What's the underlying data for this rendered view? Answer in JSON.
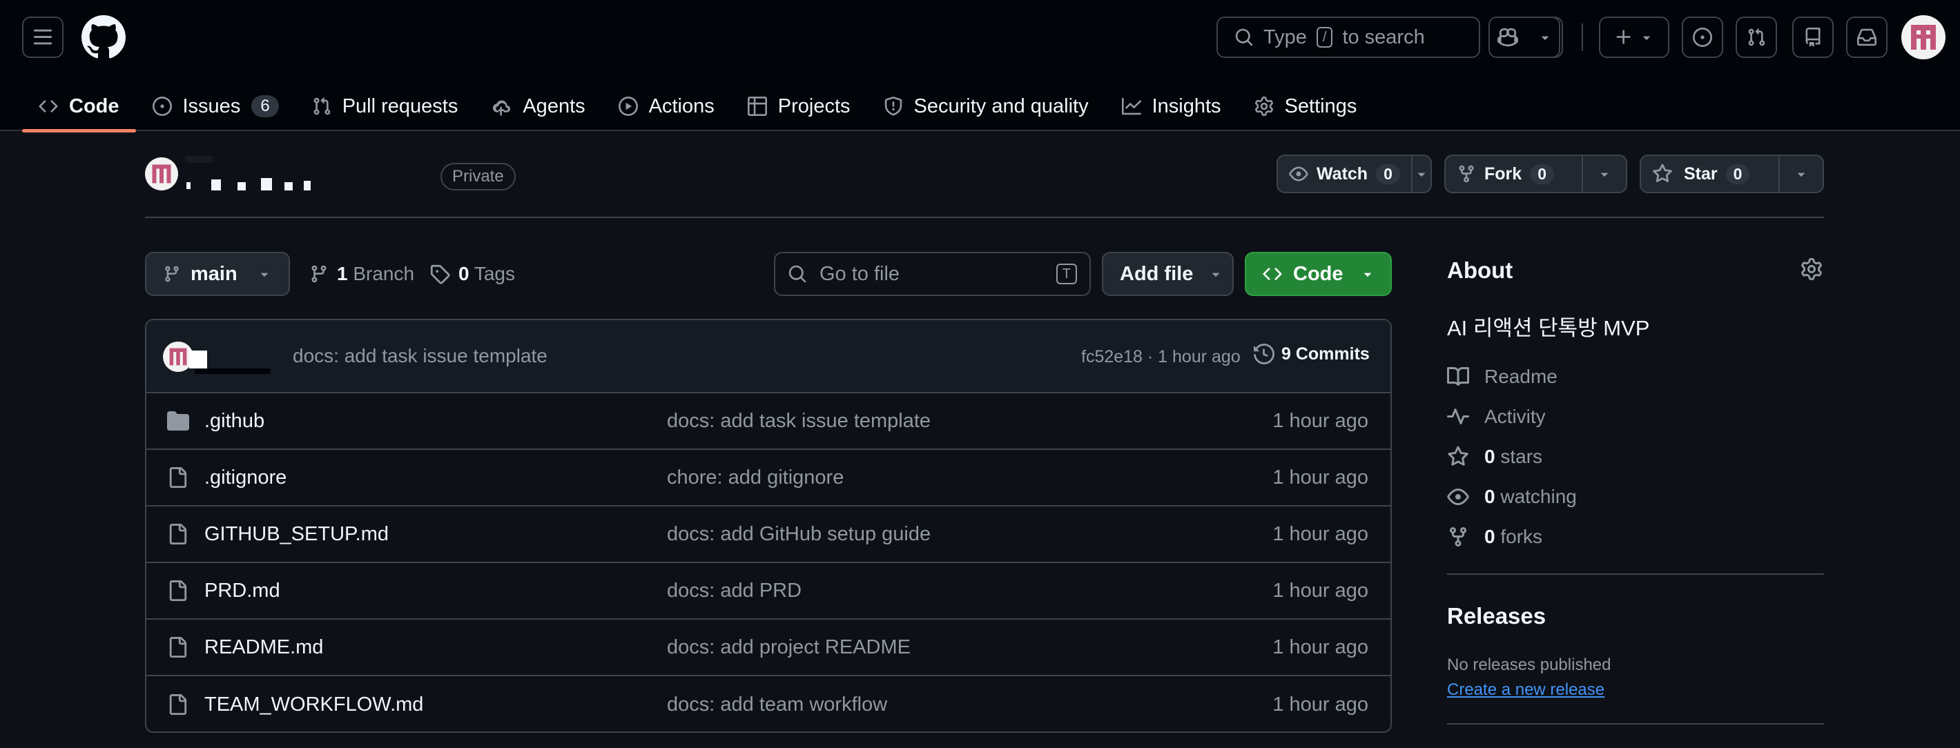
{
  "header": {
    "search_placeholder_pre": "Type",
    "search_key": "/",
    "search_placeholder_post": "to search"
  },
  "nav": {
    "code": "Code",
    "issues": "Issues",
    "issues_count": "6",
    "pull_requests": "Pull requests",
    "agents": "Agents",
    "actions": "Actions",
    "projects": "Projects",
    "security": "Security and quality",
    "insights": "Insights",
    "settings": "Settings"
  },
  "repo": {
    "visibility": "Private",
    "watch_label": "Watch",
    "watch_count": "0",
    "fork_label": "Fork",
    "fork_count": "0",
    "star_label": "Star",
    "star_count": "0"
  },
  "toolbar": {
    "branch": "main",
    "branch_count": "1",
    "branch_label": "Branch",
    "tag_count": "0",
    "tag_label": "Tags",
    "go_to_file": "Go to file",
    "go_to_file_key": "T",
    "add_file": "Add file",
    "code": "Code"
  },
  "latest_commit": {
    "message": "docs: add task issue template",
    "meta": "fc52e18 · 1 hour ago",
    "commits_count": "9",
    "commits_label": "Commits"
  },
  "files": [
    {
      "name": ".github",
      "type": "folder",
      "message": "docs: add task issue template",
      "time": "1 hour ago"
    },
    {
      "name": ".gitignore",
      "type": "file",
      "message": "chore: add gitignore",
      "time": "1 hour ago"
    },
    {
      "name": "GITHUB_SETUP.md",
      "type": "file",
      "message": "docs: add GitHub setup guide",
      "time": "1 hour ago"
    },
    {
      "name": "PRD.md",
      "type": "file",
      "message": "docs: add PRD",
      "time": "1 hour ago"
    },
    {
      "name": "README.md",
      "type": "file",
      "message": "docs: add project README",
      "time": "1 hour ago"
    },
    {
      "name": "TEAM_WORKFLOW.md",
      "type": "file",
      "message": "docs: add team workflow",
      "time": "1 hour ago"
    }
  ],
  "about": {
    "title": "About",
    "description": "AI 리액션 단톡방 MVP",
    "readme": "Readme",
    "activity": "Activity",
    "stars_count": "0",
    "stars_label": "stars",
    "watching_count": "0",
    "watching_label": "watching",
    "forks_count": "0",
    "forks_label": "forks"
  },
  "releases": {
    "title": "Releases",
    "none": "No releases published",
    "create_link": "Create a new release"
  },
  "colors": {
    "background": "#0d1117",
    "header_bg": "#010409",
    "accent_underline": "#f78166",
    "code_button": "#238636",
    "link": "#4493f8"
  }
}
